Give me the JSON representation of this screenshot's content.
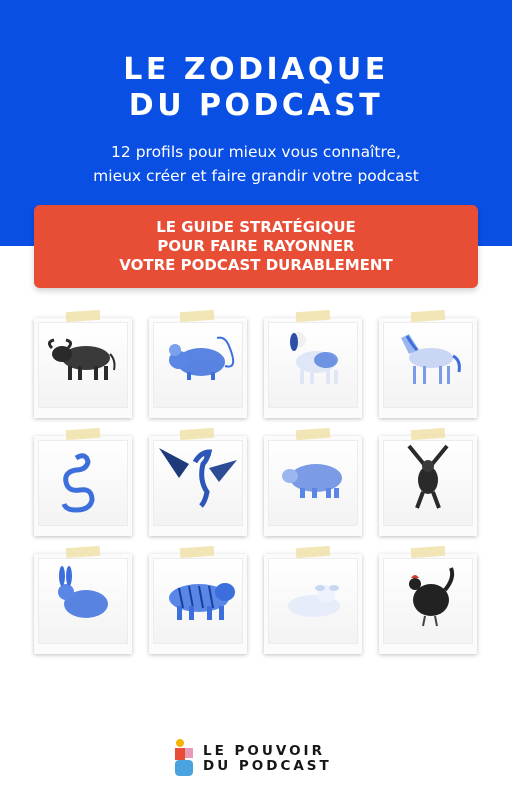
{
  "title": {
    "line1": "LE ZODIAQUE",
    "line2": "DU PODCAST"
  },
  "subtitle": {
    "line1": "12 profils pour mieux vous connaître,",
    "line2": "mieux créer et faire grandir votre podcast"
  },
  "banner": {
    "line1": "LE GUIDE STRATÉGIQUE",
    "line2": "POUR FAIRE RAYONNER",
    "line3": "VOTRE PODCAST DURABLEMENT"
  },
  "animals": [
    "buffalo",
    "rat",
    "dog",
    "horse",
    "snake",
    "dragon",
    "pig",
    "monkey",
    "rabbit",
    "tiger",
    "goat",
    "rooster"
  ],
  "logo": {
    "line1": "LE POUVOIR",
    "line2": "DU PODCAST"
  },
  "colors": {
    "hero_blue": "#0a4fe3",
    "banner_red": "#e84e36",
    "animal_blue": "#3d6fdc",
    "logo_yellow": "#f5b400",
    "logo_red": "#e84e36",
    "logo_blue": "#4aa3df",
    "logo_pink": "#e89bb6"
  }
}
